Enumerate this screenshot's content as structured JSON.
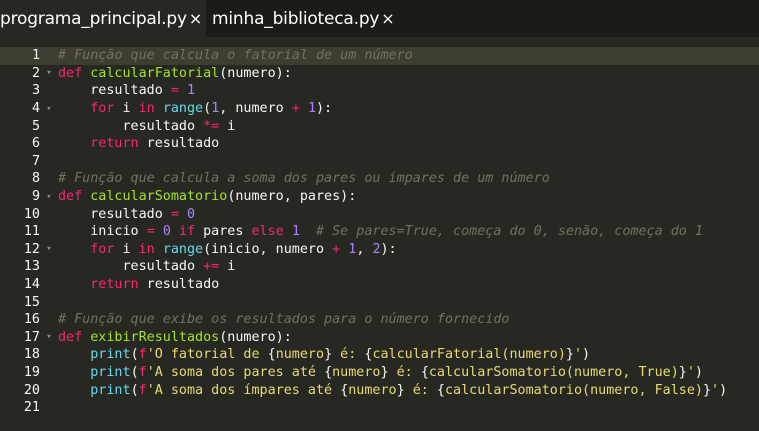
{
  "tabs": [
    {
      "label": "programa_principal.py",
      "close": "×",
      "active": true
    },
    {
      "label": "minha_biblioteca.py",
      "close": "×",
      "active": false
    }
  ],
  "lines": [
    {
      "num": "1",
      "fold": "",
      "tokens": [
        [
          "cm",
          "# Função que calcula o fatorial de um número"
        ]
      ]
    },
    {
      "num": "2",
      "fold": "▾",
      "tokens": [
        [
          "kw",
          "def "
        ],
        [
          "fn",
          "calcularFatorial"
        ],
        [
          "",
          "(numero):"
        ]
      ]
    },
    {
      "num": "3",
      "fold": "",
      "tokens": [
        [
          "",
          "    resultado "
        ],
        [
          "kw",
          "="
        ],
        [
          "",
          " "
        ],
        [
          "num",
          "1"
        ]
      ]
    },
    {
      "num": "4",
      "fold": "▾",
      "tokens": [
        [
          "",
          "    "
        ],
        [
          "kw",
          "for"
        ],
        [
          "",
          " i "
        ],
        [
          "kw",
          "in"
        ],
        [
          "",
          " "
        ],
        [
          "bi",
          "range"
        ],
        [
          "",
          "("
        ],
        [
          "num",
          "1"
        ],
        [
          "",
          ", numero "
        ],
        [
          "kw",
          "+"
        ],
        [
          "",
          " "
        ],
        [
          "num",
          "1"
        ],
        [
          "",
          "):"
        ]
      ]
    },
    {
      "num": "5",
      "fold": "",
      "tokens": [
        [
          "",
          "        resultado "
        ],
        [
          "kw",
          "*="
        ],
        [
          "",
          " i"
        ]
      ]
    },
    {
      "num": "6",
      "fold": "",
      "tokens": [
        [
          "",
          "    "
        ],
        [
          "kw",
          "return"
        ],
        [
          "",
          " resultado"
        ]
      ]
    },
    {
      "num": "7",
      "fold": "",
      "tokens": []
    },
    {
      "num": "8",
      "fold": "",
      "tokens": [
        [
          "cm",
          "# Função que calcula a soma dos pares ou ímpares de um número"
        ]
      ]
    },
    {
      "num": "9",
      "fold": "▾",
      "tokens": [
        [
          "kw",
          "def "
        ],
        [
          "fn",
          "calcularSomatorio"
        ],
        [
          "",
          "(numero, pares):"
        ]
      ]
    },
    {
      "num": "10",
      "fold": "",
      "tokens": [
        [
          "",
          "    resultado "
        ],
        [
          "kw",
          "="
        ],
        [
          "",
          " "
        ],
        [
          "num",
          "0"
        ]
      ]
    },
    {
      "num": "11",
      "fold": "",
      "tokens": [
        [
          "",
          "    inicio "
        ],
        [
          "kw",
          "="
        ],
        [
          "",
          " "
        ],
        [
          "num",
          "0"
        ],
        [
          "",
          " "
        ],
        [
          "kw",
          "if"
        ],
        [
          "",
          " pares "
        ],
        [
          "kw",
          "else"
        ],
        [
          "",
          " "
        ],
        [
          "num",
          "1"
        ],
        [
          "",
          "  "
        ],
        [
          "cm",
          "# Se pares=True, começa do 0, senão, começa do 1"
        ]
      ]
    },
    {
      "num": "12",
      "fold": "▾",
      "tokens": [
        [
          "",
          "    "
        ],
        [
          "kw",
          "for"
        ],
        [
          "",
          " i "
        ],
        [
          "kw",
          "in"
        ],
        [
          "",
          " "
        ],
        [
          "bi",
          "range"
        ],
        [
          "",
          "(inicio, numero "
        ],
        [
          "kw",
          "+"
        ],
        [
          "",
          " "
        ],
        [
          "num",
          "1"
        ],
        [
          "",
          ", "
        ],
        [
          "num",
          "2"
        ],
        [
          "",
          "):"
        ]
      ]
    },
    {
      "num": "13",
      "fold": "",
      "tokens": [
        [
          "",
          "        resultado "
        ],
        [
          "kw",
          "+="
        ],
        [
          "",
          " i"
        ]
      ]
    },
    {
      "num": "14",
      "fold": "",
      "tokens": [
        [
          "",
          "    "
        ],
        [
          "kw",
          "return"
        ],
        [
          "",
          " resultado"
        ]
      ]
    },
    {
      "num": "15",
      "fold": "",
      "tokens": []
    },
    {
      "num": "16",
      "fold": "",
      "tokens": [
        [
          "cm",
          "# Função que exibe os resultados para o número fornecido"
        ]
      ]
    },
    {
      "num": "17",
      "fold": "▾",
      "tokens": [
        [
          "kw",
          "def "
        ],
        [
          "fn",
          "exibirResultados"
        ],
        [
          "",
          "(numero):"
        ]
      ]
    },
    {
      "num": "18",
      "fold": "",
      "tokens": [
        [
          "",
          "    "
        ],
        [
          "bi",
          "print"
        ],
        [
          "",
          "("
        ],
        [
          "kw",
          "f"
        ],
        [
          "st",
          "'O fatorial de "
        ],
        [
          "",
          "{"
        ],
        [
          "st",
          "numero"
        ],
        [
          "",
          "}"
        ],
        [
          "st",
          " é: "
        ],
        [
          "",
          "{"
        ],
        [
          "st",
          "calcularFatorial(numero)"
        ],
        [
          "",
          "}"
        ],
        [
          "st",
          "'"
        ],
        [
          "",
          ")"
        ]
      ]
    },
    {
      "num": "19",
      "fold": "",
      "tokens": [
        [
          "",
          "    "
        ],
        [
          "bi",
          "print"
        ],
        [
          "",
          "("
        ],
        [
          "kw",
          "f"
        ],
        [
          "st",
          "'A soma dos pares até "
        ],
        [
          "",
          "{"
        ],
        [
          "st",
          "numero"
        ],
        [
          "",
          "}"
        ],
        [
          "st",
          " é: "
        ],
        [
          "",
          "{"
        ],
        [
          "st",
          "calcularSomatorio(numero, True)"
        ],
        [
          "",
          "}"
        ],
        [
          "st",
          "'"
        ],
        [
          "",
          ")"
        ]
      ]
    },
    {
      "num": "20",
      "fold": "",
      "tokens": [
        [
          "",
          "    "
        ],
        [
          "bi",
          "print"
        ],
        [
          "",
          "("
        ],
        [
          "kw",
          "f"
        ],
        [
          "st",
          "'A soma dos ímpares até "
        ],
        [
          "",
          "{"
        ],
        [
          "st",
          "numero"
        ],
        [
          "",
          "}"
        ],
        [
          "st",
          " é: "
        ],
        [
          "",
          "{"
        ],
        [
          "st",
          "calcularSomatorio(numero, False)"
        ],
        [
          "",
          "}"
        ],
        [
          "st",
          "'"
        ],
        [
          "",
          ")"
        ]
      ]
    },
    {
      "num": "21",
      "fold": "",
      "tokens": []
    }
  ],
  "current_line": 0
}
